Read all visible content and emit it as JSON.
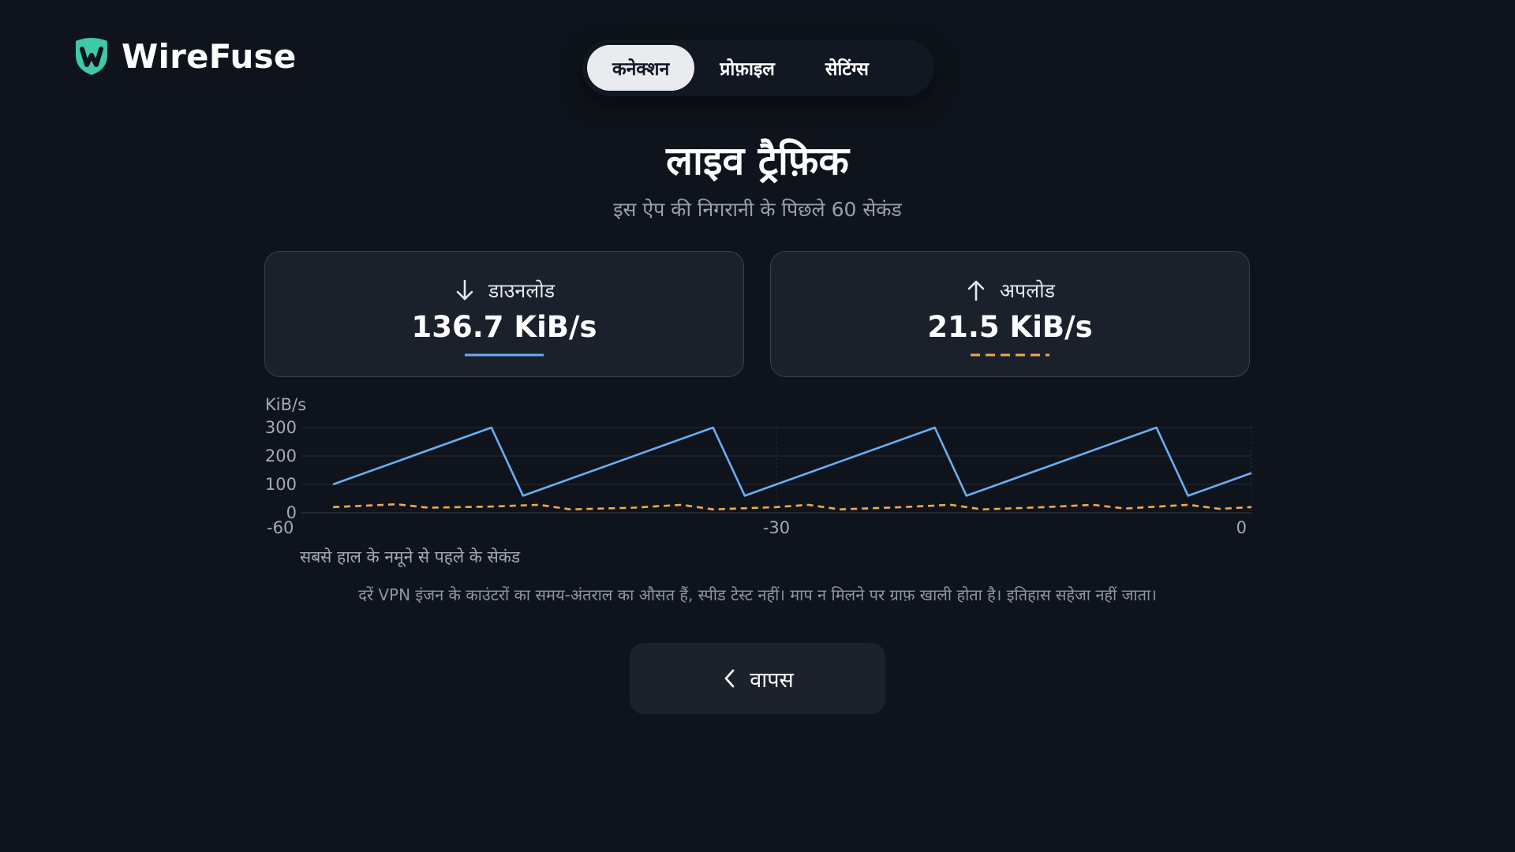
{
  "app": {
    "name": "WireFuse",
    "accent": "#3fc9a6"
  },
  "tabs": [
    {
      "label": "कनेक्शन",
      "active": true
    },
    {
      "label": "प्रोफ़ाइल",
      "active": false
    },
    {
      "label": "सेटिंग्स",
      "active": false
    }
  ],
  "header": {
    "title": "लाइव ट्रैफ़िक",
    "subtitle": "इस ऐप की निगरानी के पिछले 60 सेकंड"
  },
  "stats": {
    "download": {
      "label": "डाउनलोड",
      "value": "136.7 KiB/s",
      "icon": "arrow-down-icon",
      "color": "#6aaef5"
    },
    "upload": {
      "label": "अपलोड",
      "value": "21.5 KiB/s",
      "icon": "arrow-up-icon",
      "color": "#f3a94f"
    }
  },
  "chart_data": {
    "type": "line",
    "ylabel": "KiB/s",
    "xlabel": "सबसे हाल के नमूने से पहले के सेकंड",
    "xlim": [
      -60,
      0
    ],
    "ylim": [
      0,
      300
    ],
    "x_ticks": [
      -60,
      -30,
      0
    ],
    "y_ticks": [
      0,
      100,
      200,
      300
    ],
    "grid": true,
    "series": [
      {
        "key": "download",
        "style": "solid",
        "color": "#6aaef5",
        "points": [
          [
            -58,
            100
          ],
          [
            -48,
            300
          ],
          [
            -46,
            60
          ],
          [
            -34,
            300
          ],
          [
            -32,
            60
          ],
          [
            -20,
            300
          ],
          [
            -18,
            60
          ],
          [
            -6,
            300
          ],
          [
            -4,
            60
          ],
          [
            0,
            140
          ]
        ]
      },
      {
        "key": "upload",
        "style": "dashed",
        "color": "#f3a94f",
        "points": [
          [
            -58,
            20
          ],
          [
            -54,
            30
          ],
          [
            -52,
            18
          ],
          [
            -48,
            22
          ],
          [
            -45,
            28
          ],
          [
            -43,
            12
          ],
          [
            -39,
            18
          ],
          [
            -36,
            28
          ],
          [
            -34,
            12
          ],
          [
            -30,
            20
          ],
          [
            -28,
            28
          ],
          [
            -26,
            12
          ],
          [
            -22,
            20
          ],
          [
            -19,
            28
          ],
          [
            -17,
            12
          ],
          [
            -13,
            20
          ],
          [
            -10,
            28
          ],
          [
            -8,
            15
          ],
          [
            -4,
            28
          ],
          [
            -2,
            14
          ],
          [
            0,
            20
          ]
        ]
      }
    ]
  },
  "disclaimer": "दरें VPN इंजन के काउंटरों का समय-अंतराल का औसत हैं, स्पीड टेस्ट नहीं। माप न मिलने पर ग्राफ़ खाली होता है। इतिहास सहेजा नहीं जाता।",
  "back_button": {
    "label": "वापस",
    "icon": "chevron-left-icon"
  }
}
